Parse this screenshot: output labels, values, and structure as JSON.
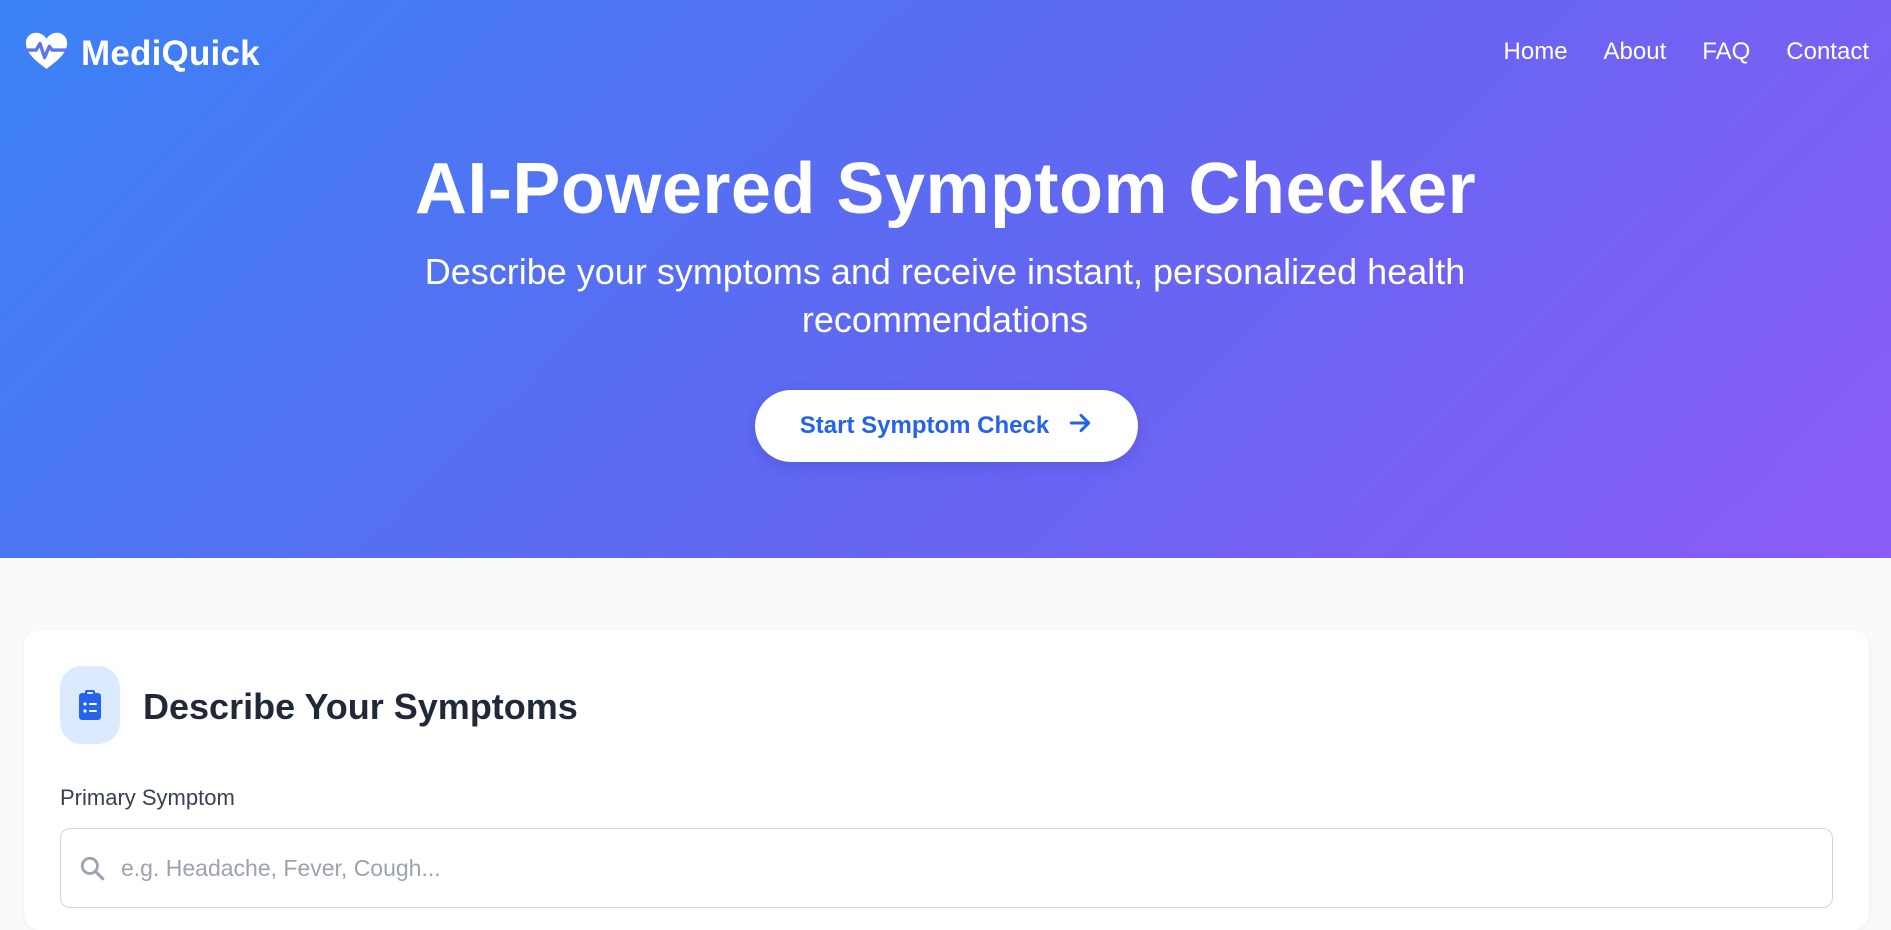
{
  "brand": {
    "name": "MediQuick",
    "icon": "heart-pulse-icon"
  },
  "nav": {
    "links": [
      {
        "label": "Home"
      },
      {
        "label": "About"
      },
      {
        "label": "FAQ"
      },
      {
        "label": "Contact"
      }
    ]
  },
  "hero": {
    "title": "AI-Powered Symptom Checker",
    "subtitle": "Describe your symptoms and receive instant, personalized health recommendations",
    "cta_label": "Start Symptom Check",
    "cta_icon": "arrow-right-icon"
  },
  "symptoms_card": {
    "icon": "clipboard-list-icon",
    "title": "Describe Your Symptoms",
    "primary_label": "Primary Symptom",
    "primary_placeholder": "e.g. Headache, Fever, Cough...",
    "primary_value": "",
    "search_icon": "search-icon"
  },
  "colors": {
    "gradient_start": "#3b82f6",
    "gradient_end": "#8b5cf6",
    "accent": "#2563eb",
    "page_bg": "#f8fafc"
  }
}
